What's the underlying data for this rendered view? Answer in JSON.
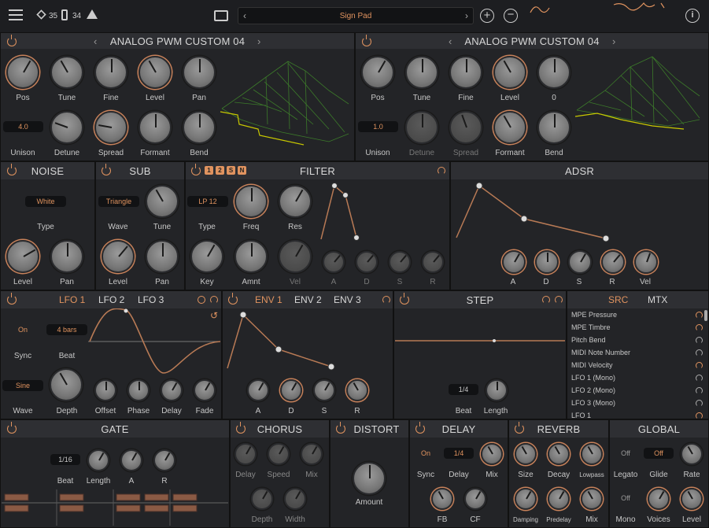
{
  "topbar": {
    "cpu": "35",
    "ram": "34",
    "preset": "Sign Pad"
  },
  "osc1": {
    "title": "ANALOG PWM CUSTOM 04",
    "labels": [
      "Pos",
      "Tune",
      "Fine",
      "Level",
      "Pan",
      "Unison",
      "Detune",
      "Spread",
      "Formant",
      "Bend"
    ],
    "unison": "4.0"
  },
  "osc2": {
    "title": "ANALOG PWM CUSTOM 04",
    "labels": [
      "Pos",
      "Tune",
      "Fine",
      "Level",
      "0",
      "Unison",
      "Detune",
      "Spread",
      "Formant",
      "Bend"
    ],
    "unison": "1.0"
  },
  "noise": {
    "title": "NOISE",
    "type": "White",
    "labels": [
      "Type",
      "Level",
      "Pan"
    ]
  },
  "sub": {
    "title": "SUB",
    "wave": "Triangle",
    "labels": [
      "Wave",
      "Tune",
      "Level",
      "Pan"
    ]
  },
  "filter": {
    "title": "FILTER",
    "badges": [
      "1",
      "2",
      "S",
      "N"
    ],
    "type": "LP 12",
    "labels": [
      "Type",
      "Freq",
      "Res",
      "Key",
      "Amnt",
      "Vel",
      "A",
      "D",
      "S",
      "R"
    ]
  },
  "adsr": {
    "title": "ADSR",
    "labels": [
      "A",
      "D",
      "S",
      "R",
      "Vel"
    ]
  },
  "lfo": {
    "tabs": [
      "LFO 1",
      "LFO 2",
      "LFO 3"
    ],
    "sync": "On",
    "beat": "4 bars",
    "wave": "Sine",
    "labels": [
      "Sync",
      "Beat",
      "Wave",
      "Depth",
      "Offset",
      "Phase",
      "Delay",
      "Fade"
    ]
  },
  "env": {
    "tabs": [
      "ENV 1",
      "ENV 2",
      "ENV 3"
    ],
    "labels": [
      "A",
      "D",
      "S",
      "R"
    ]
  },
  "step": {
    "title": "STEP",
    "beat": "1/4",
    "labels": [
      "Beat",
      "Length"
    ]
  },
  "mtx": {
    "tabs": [
      "SRC",
      "MTX"
    ],
    "items": [
      "MPE Pressure",
      "MPE Timbre",
      "Pitch Bend",
      "MIDI Note Number",
      "MIDI Velocity",
      "LFO 1 (Mono)",
      "LFO 2 (Mono)",
      "LFO 3 (Mono)",
      "LFO 1"
    ]
  },
  "gate": {
    "title": "GATE",
    "beat": "1/16",
    "labels": [
      "Beat",
      "Length",
      "A",
      "R"
    ]
  },
  "chorus": {
    "title": "CHORUS",
    "labels": [
      "Delay",
      "Speed",
      "Mix",
      "Depth",
      "Width"
    ]
  },
  "distort": {
    "title": "DISTORT",
    "labels": [
      "Amount"
    ]
  },
  "delay": {
    "title": "DELAY",
    "sync": "On",
    "time": "1/4",
    "labels": [
      "Sync",
      "Delay",
      "Mix",
      "FB",
      "CF"
    ]
  },
  "reverb": {
    "title": "REVERB",
    "labels": [
      "Size",
      "Decay",
      "Lowpass",
      "Damping",
      "Predelay",
      "Mix"
    ]
  },
  "global": {
    "title": "GLOBAL",
    "legato": "Off",
    "glide": "Off",
    "mono": "Off",
    "labels": [
      "Legato",
      "Glide",
      "Rate",
      "Mono",
      "Voices",
      "Level"
    ]
  }
}
